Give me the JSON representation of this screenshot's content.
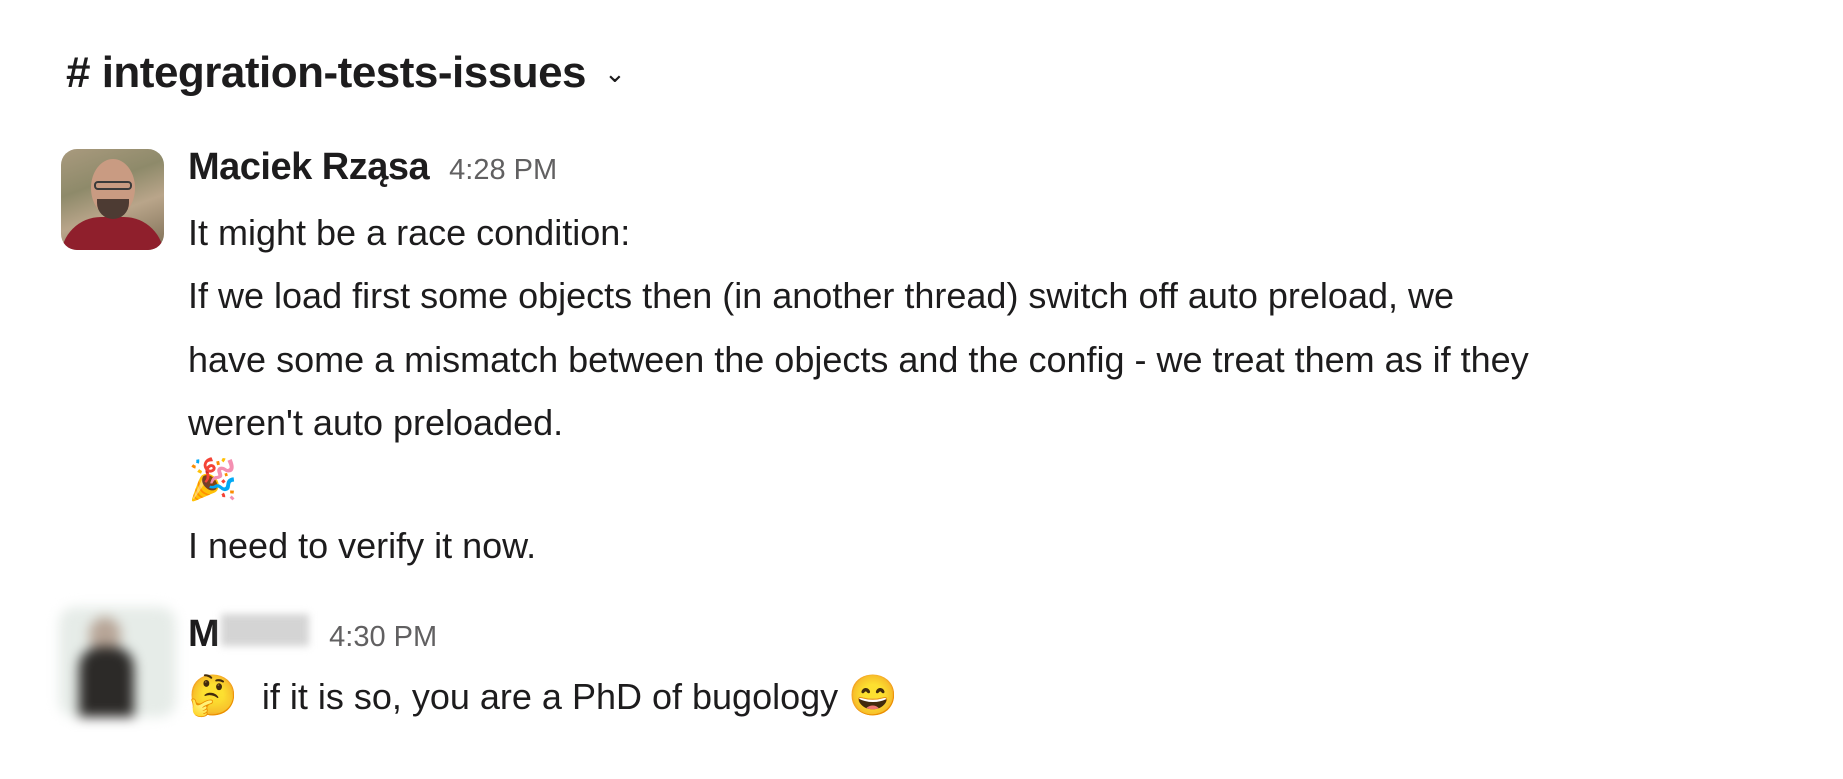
{
  "channel": {
    "name": "# integration-tests-issues",
    "chevron_icon": "chevron-down-icon"
  },
  "messages": [
    {
      "author": "Maciek Rząsa",
      "time": "4:28 PM",
      "lines": [
        "It might be a race condition:",
        "If we load first some objects then (in another thread) switch off auto preload, we",
        "have some a mismatch between the objects and the config - we treat them as if they",
        "weren't auto preloaded.",
        "🎉",
        "I need to verify it now."
      ]
    },
    {
      "author": "M",
      "time": "4:30 PM",
      "emoji_lead": "🤔",
      "text": "if it is so, you are a PhD of bugology",
      "emoji_trail": "😄"
    }
  ]
}
